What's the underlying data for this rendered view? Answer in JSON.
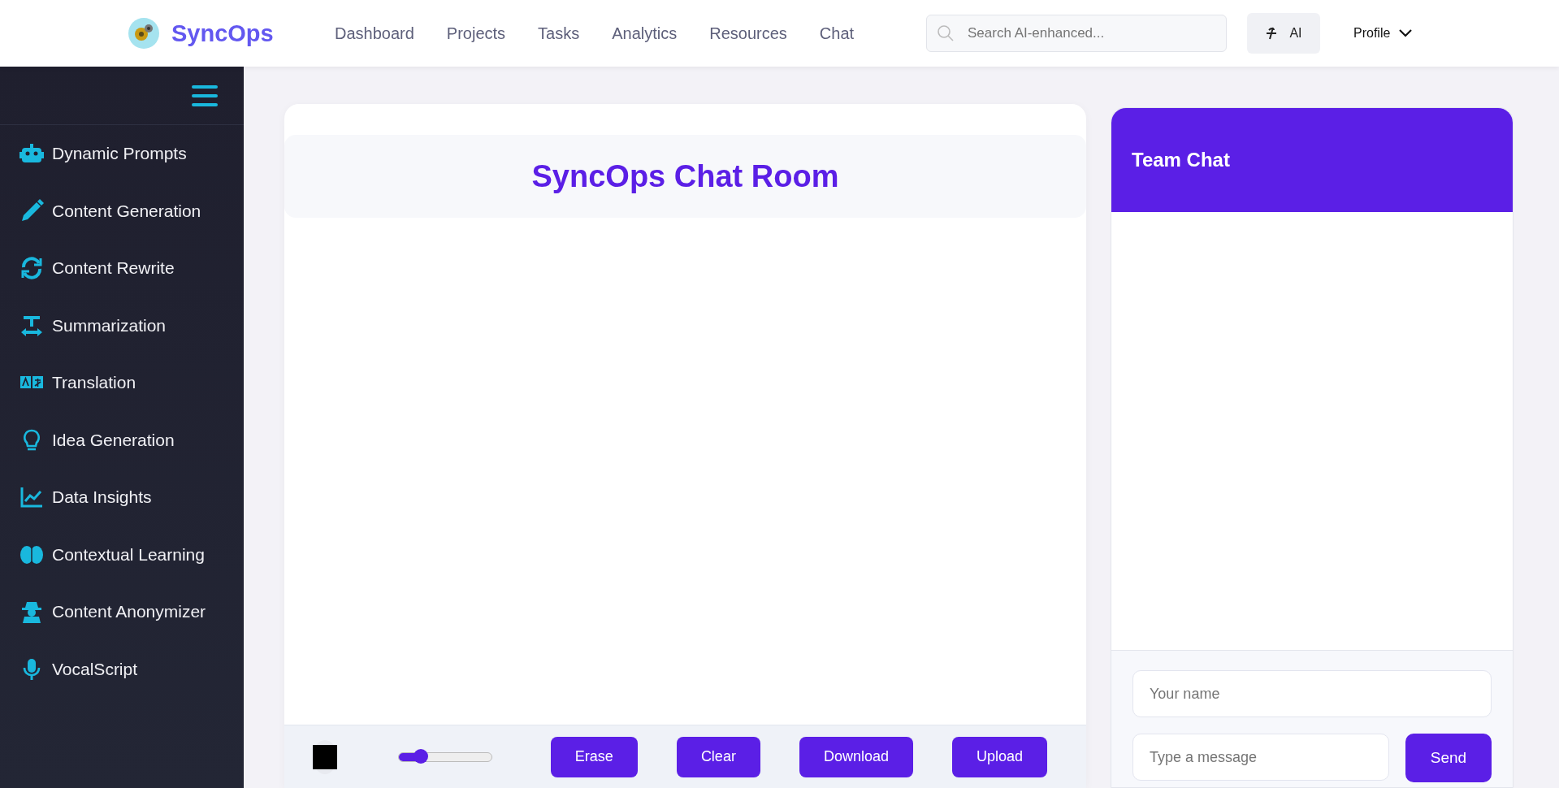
{
  "brand": "SyncOps",
  "nav": [
    {
      "label": "Dashboard"
    },
    {
      "label": "Projects"
    },
    {
      "label": "Tasks"
    },
    {
      "label": "Analytics"
    },
    {
      "label": "Resources"
    },
    {
      "label": "Chat"
    }
  ],
  "search": {
    "placeholder": "Search AI-enhanced..."
  },
  "ai_button": "AI",
  "profile": "Profile",
  "sidebar": {
    "items": [
      {
        "label": "Dynamic Prompts"
      },
      {
        "label": "Content Generation"
      },
      {
        "label": "Content Rewrite"
      },
      {
        "label": "Summarization"
      },
      {
        "label": "Translation"
      },
      {
        "label": "Idea Generation"
      },
      {
        "label": "Data Insights"
      },
      {
        "label": "Contextual Learning"
      },
      {
        "label": "Content Anonymizer"
      },
      {
        "label": "VocalScript"
      }
    ]
  },
  "canvas": {
    "title": "SyncOps Chat Room",
    "pen": {
      "color": "#000000"
    },
    "brush_size": {
      "level": 0.24
    },
    "buttons": [
      "Erase",
      "Clear",
      "Download",
      "Upload"
    ]
  },
  "chat": {
    "title": "Team Chat",
    "name_field": {
      "placeholder": "Your name"
    },
    "message_field": {
      "placeholder": "Type a message"
    },
    "send": "Send"
  }
}
